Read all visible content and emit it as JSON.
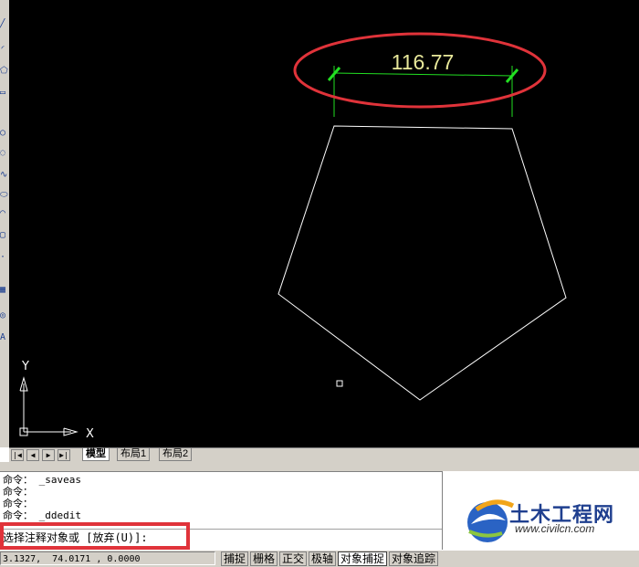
{
  "drawing": {
    "dimension_value": "116.77",
    "axis_x_label": "X",
    "axis_y_label": "Y"
  },
  "layout_tabs": [
    {
      "label": "模型",
      "active": true
    },
    {
      "label": "布局1",
      "active": false
    },
    {
      "label": "布局2",
      "active": false
    }
  ],
  "nav_buttons": [
    "|◀",
    "◀",
    "▶",
    "▶|"
  ],
  "command_history": [
    "命令： _saveas",
    "命令：",
    "命令：",
    "命令： _ddedit"
  ],
  "command_prompt": "选择注释对象或 [放弃(U)]:",
  "status": {
    "coordinates": "3.1327,  74.0171 , 0.0000",
    "toggles": [
      {
        "label": "捕捉",
        "on": false
      },
      {
        "label": "栅格",
        "on": false
      },
      {
        "label": "正交",
        "on": false
      },
      {
        "label": "极轴",
        "on": false
      },
      {
        "label": "对象捕捉",
        "on": true
      },
      {
        "label": "对象追踪",
        "on": false
      }
    ]
  },
  "watermark": {
    "title": "土木工程网",
    "url": "www.civilcn.com"
  },
  "colors": {
    "canvas_bg": "#000000",
    "geometry": "#ffffff",
    "dimension_text": "#e8e89a",
    "dimension_line": "#22e022",
    "highlight": "#e0333a"
  }
}
